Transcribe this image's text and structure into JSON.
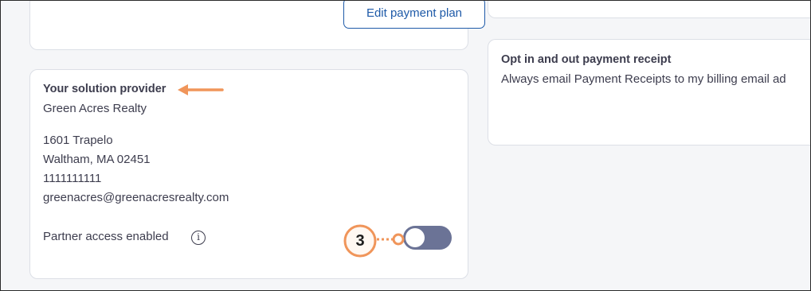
{
  "top_card": {
    "edit_button_label": "Edit payment plan"
  },
  "receipt_card": {
    "title": "Opt in and out payment receipt",
    "description": "Always email Payment Receipts to my billing email ad"
  },
  "provider_card": {
    "title": "Your solution provider",
    "name": "Green Acres Realty",
    "address_lines": [
      "1601 Trapelo",
      "Waltham, MA 02451",
      "1111111111",
      "greenacres@greenacresrealty.com"
    ],
    "partner_access_label": "Partner access enabled",
    "partner_access_enabled": false
  },
  "annotations": {
    "step_number": "3",
    "accent_color": "#f0955a"
  },
  "icons": {
    "info": "info-icon",
    "arrow": "arrow-left-icon"
  },
  "colors": {
    "link_blue": "#1e5aa8",
    "toggle_bg": "#6b7396",
    "text": "#3d3d4e"
  }
}
